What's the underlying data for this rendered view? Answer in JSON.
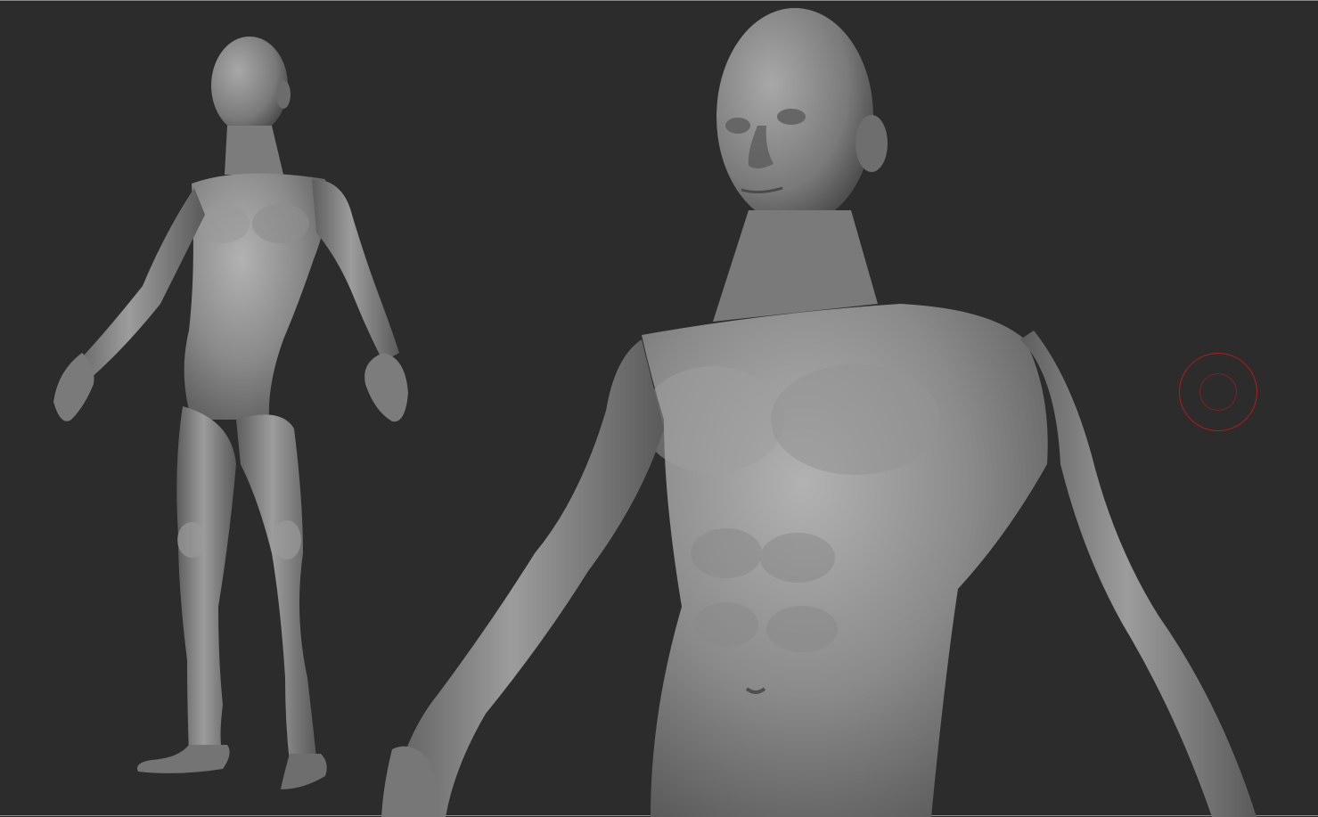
{
  "viewport": {
    "background": "#2c2c2c",
    "frame_color": "#8a8a8a"
  },
  "model": {
    "material": "gray clay",
    "views": [
      "full-body",
      "torso-closeup"
    ],
    "skin_base": "#8c8c8c",
    "skin_shadow": "#555555",
    "skin_highlight": "#b6b6b6"
  },
  "cursor": {
    "icon": "brush-cursor-icon",
    "color": "#b31b1b"
  }
}
